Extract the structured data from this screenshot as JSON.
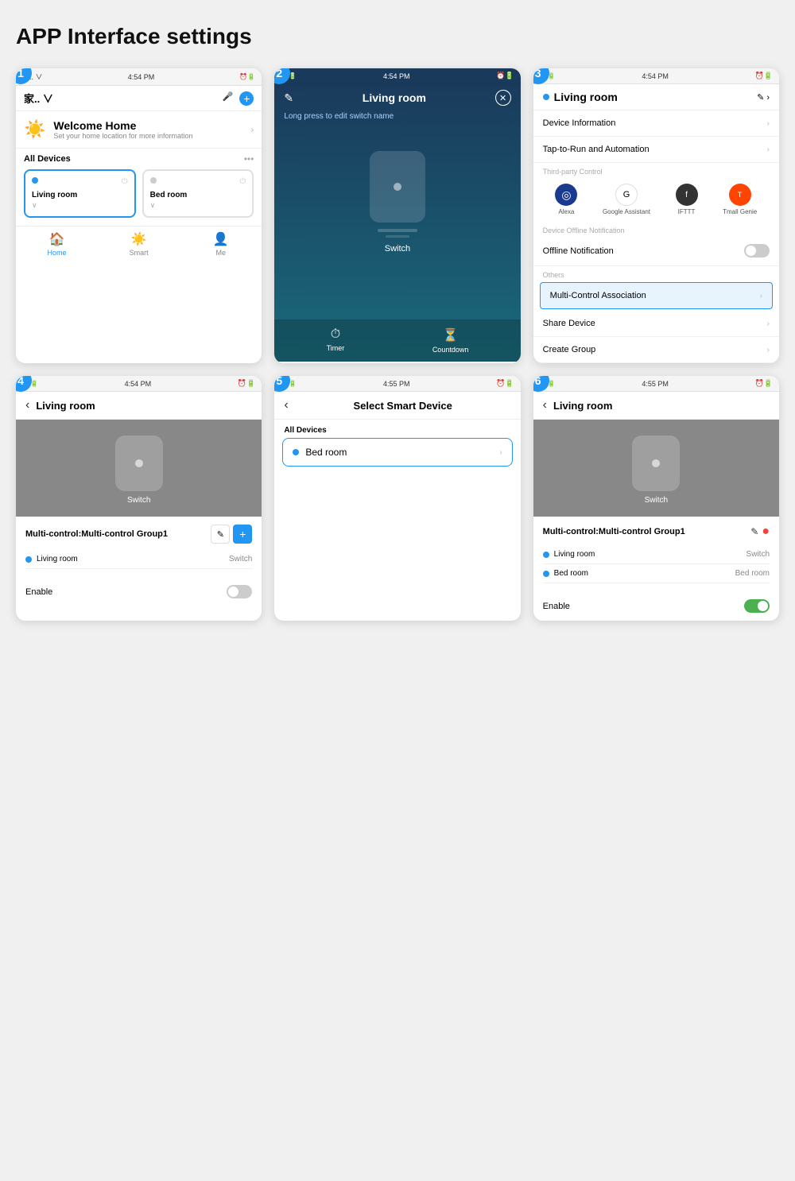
{
  "page": {
    "title": "APP Interface settings"
  },
  "screen1": {
    "step": "1",
    "status_bar": {
      "left": "家.. ∨",
      "time": "4:54 PM",
      "icons": "⏰ 🔋"
    },
    "welcome": {
      "title": "Welcome Home",
      "subtitle": "Set your home location for more information"
    },
    "all_devices_label": "All Devices",
    "devices": [
      {
        "name": "Living room",
        "active": true
      },
      {
        "name": "Bed room",
        "active": false
      }
    ],
    "nav": [
      {
        "label": "Home",
        "active": true,
        "icon": "🏠"
      },
      {
        "label": "Smart",
        "active": false,
        "icon": "☀️"
      },
      {
        "label": "Me",
        "active": false,
        "icon": "👤"
      }
    ]
  },
  "screen2": {
    "step": "2",
    "status_bar": {
      "time": "4:54 PM"
    },
    "title": "Living room",
    "hint": "Long press to edit switch name",
    "device_label": "Switch",
    "bottom_actions": [
      {
        "label": "Timer",
        "icon": "⏱"
      },
      {
        "label": "Countdown",
        "icon": "⏳"
      }
    ]
  },
  "screen3": {
    "step": "3",
    "status_bar": {
      "time": "4:54 PM"
    },
    "device_name": "Living room",
    "menu_items": [
      {
        "label": "Device Information",
        "highlighted": false
      },
      {
        "label": "Tap-to-Run and Automation",
        "highlighted": false
      }
    ],
    "third_party_label": "Third-party Control",
    "third_party": [
      {
        "label": "Alexa",
        "icon": "◎"
      },
      {
        "label": "Google Assistant",
        "icon": "G"
      },
      {
        "label": "IFTTT",
        "icon": "f"
      },
      {
        "label": "Tmall Genie",
        "icon": "T"
      }
    ],
    "offline_label": "Device Offline Notification",
    "offline_toggle_label": "Offline Notification",
    "others_label": "Others",
    "others_items": [
      {
        "label": "Multi-Control Association",
        "highlighted": true
      },
      {
        "label": "Share Device",
        "highlighted": false
      },
      {
        "label": "Create Group",
        "highlighted": false
      }
    ]
  },
  "screen4": {
    "step": "4",
    "status_bar": {
      "time": "4:54 PM"
    },
    "title": "Living room",
    "device_label": "Switch",
    "mc_title": "Multi-control:Multi-control Group1",
    "devices": [
      {
        "name": "Living room",
        "type": "Switch"
      }
    ],
    "enable_label": "Enable"
  },
  "screen5": {
    "step": "5",
    "status_bar": {
      "time": "4:55 PM"
    },
    "title": "Select Smart Device",
    "all_devices_label": "All Devices",
    "devices": [
      {
        "name": "Bed room"
      }
    ]
  },
  "screen6": {
    "step": "6",
    "status_bar": {
      "time": "4:55 PM"
    },
    "title": "Living room",
    "device_label": "Switch",
    "mc_title": "Multi-control:Multi-control Group1",
    "devices": [
      {
        "name": "Living room",
        "type": "Switch"
      },
      {
        "name": "Bed room",
        "type": "Bed room"
      }
    ],
    "enable_label": "Enable"
  }
}
